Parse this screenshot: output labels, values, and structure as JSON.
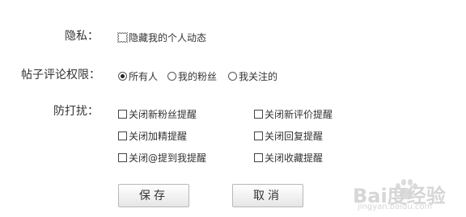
{
  "privacy": {
    "label": "隐私：",
    "hide_activity": "隐藏我的个人动态"
  },
  "comment_permission": {
    "label": "帖子评论权限：",
    "options": [
      "所有人",
      "我的粉丝",
      "我关注的"
    ],
    "selected": "所有人"
  },
  "disturb": {
    "label": "防打扰：",
    "options": [
      "关闭新粉丝提醒",
      "关闭新评价提醒",
      "关闭加精提醒",
      "关闭回复提醒",
      "关闭@提到我提醒",
      "关闭收藏提醒"
    ]
  },
  "buttons": {
    "save": "保存",
    "cancel": "取消"
  },
  "watermark": {
    "logo": "Bai度经验",
    "url": "jingyan.baidu.com"
  }
}
